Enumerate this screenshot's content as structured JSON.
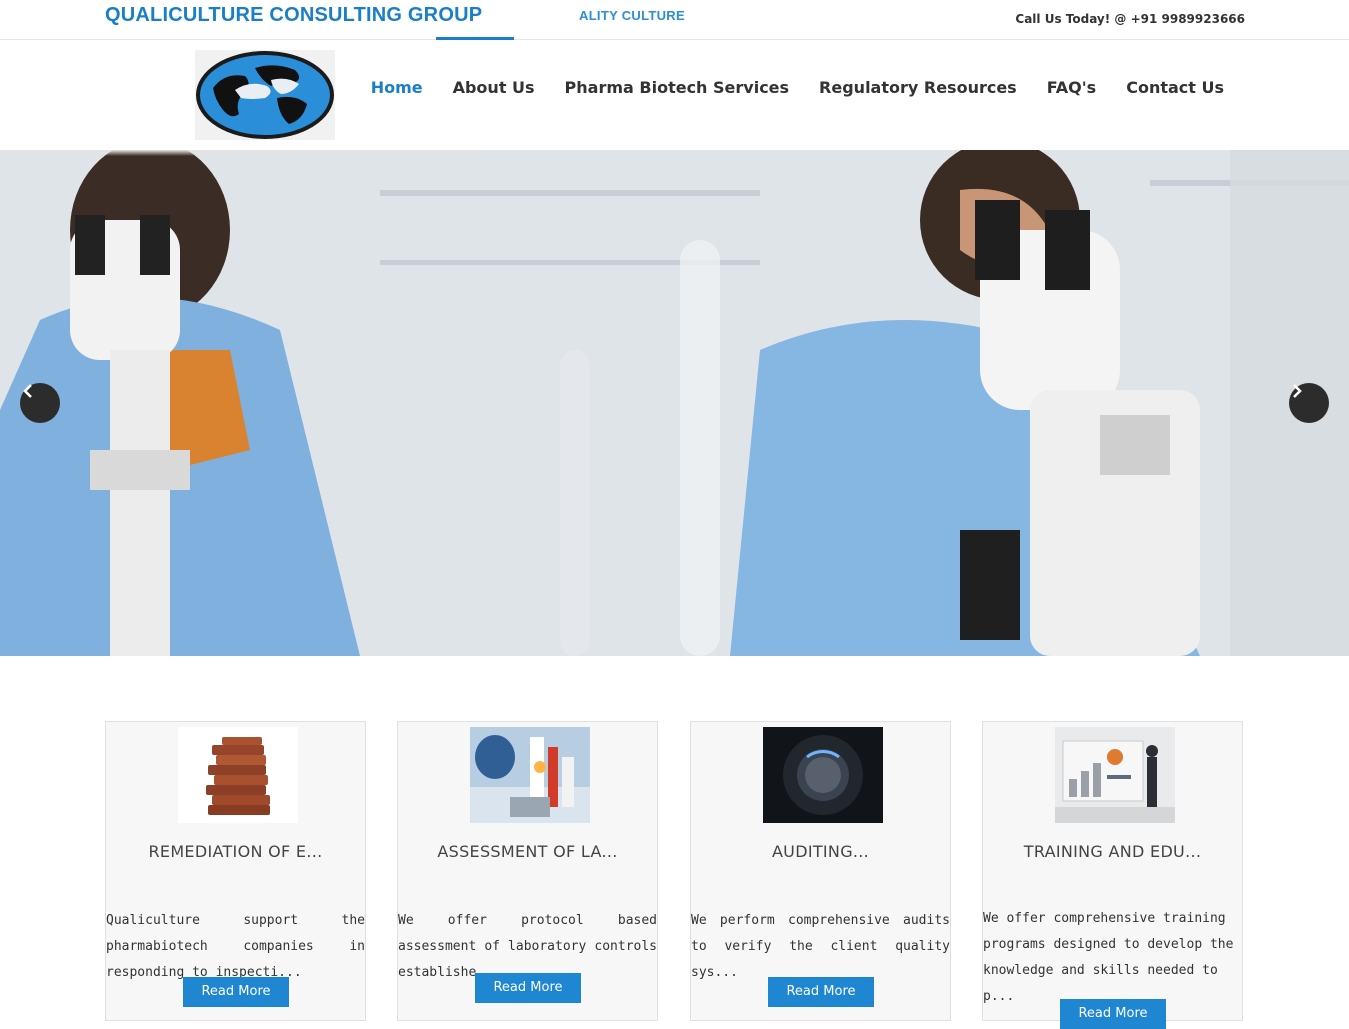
{
  "topbar": {
    "brand": "QUALICULTURE CONSULTING GROUP",
    "tagline": "ALITY CULTURE",
    "call_us": "Call Us Today! @ +91 9989923666"
  },
  "nav": {
    "items": [
      {
        "label": "Home",
        "active": true
      },
      {
        "label": "About Us"
      },
      {
        "label": "Pharma Biotech Services"
      },
      {
        "label": "Regulatory Resources"
      },
      {
        "label": "FAQ's"
      },
      {
        "label": "Contact Us"
      }
    ]
  },
  "slider": {
    "prev_icon": "chevron-left-icon",
    "next_icon": "chevron-right-icon"
  },
  "cards": [
    {
      "title": "REMEDIATION OF E...",
      "text": "Qualiculture support the pharmabiotech companies in responding to inspecti...",
      "button": "Read More",
      "image": "stacked-books-image"
    },
    {
      "title": "ASSESSMENT OF LA...",
      "text": "We offer protocol based assessment of laboratory controls establishe...",
      "button": "Read More",
      "image": "laboratory-image"
    },
    {
      "title": "AUDITING...",
      "text": "We perform comprehensive audits to verify the client quality sys...",
      "button": "Read More",
      "image": "quality-dial-image"
    },
    {
      "title": "TRAINING AND EDU...",
      "text": " We offer comprehensive training programs designed to develop the knowledge and skills needed to p...",
      "button": "Read More",
      "image": "training-board-image"
    }
  ],
  "colors": {
    "brand_blue": "#1a7fc7",
    "button_blue": "#1f86d1",
    "arrow_bg": "#2c2c2c"
  }
}
